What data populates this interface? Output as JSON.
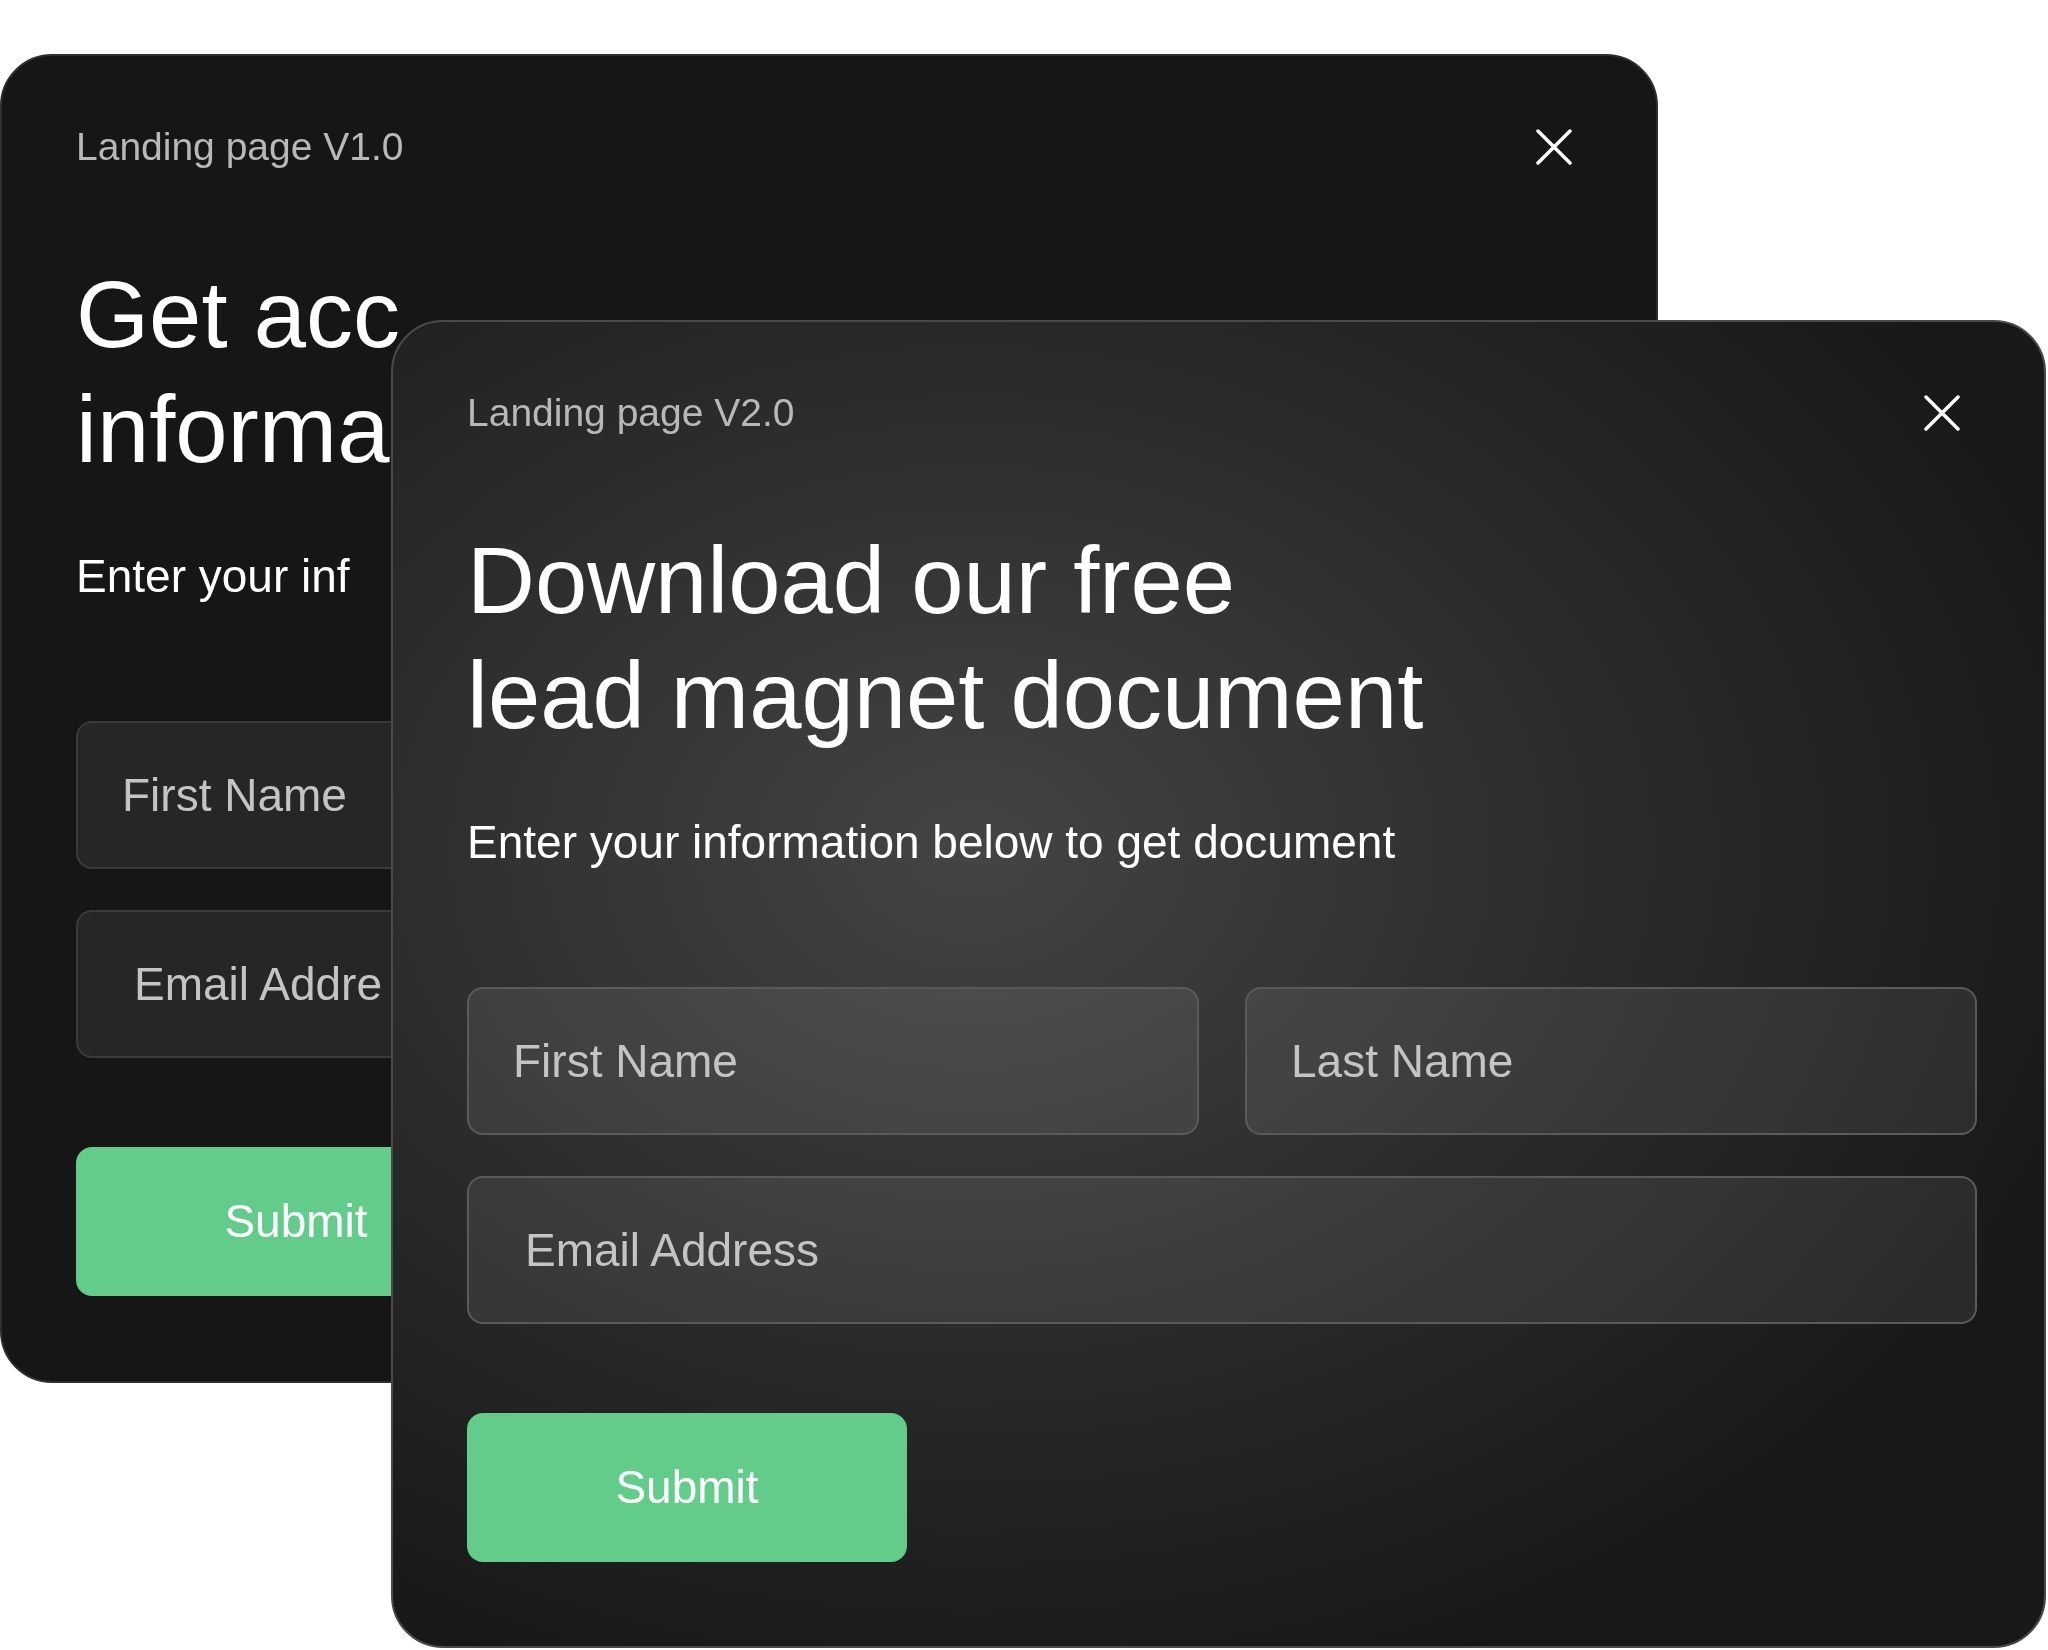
{
  "windows": [
    {
      "title": "Landing page V1.0",
      "heading_lines": [
        "Get acc",
        "informa"
      ],
      "subtitle": "Enter your inf",
      "fields": [
        {
          "kind": "half",
          "placeholder": "First Name"
        },
        {
          "kind": "full",
          "placeholder": "Email Addre"
        }
      ],
      "submit": "Submit"
    },
    {
      "title": "Landing page V2.0",
      "heading_lines": [
        "Download our free",
        "lead magnet document"
      ],
      "subtitle": "Enter your information below to get document",
      "fields": [
        {
          "kind": "half",
          "placeholder": "First Name"
        },
        {
          "kind": "half",
          "placeholder": "Last Name"
        },
        {
          "kind": "full",
          "placeholder": "Email Address"
        }
      ],
      "submit": "Submit"
    }
  ]
}
